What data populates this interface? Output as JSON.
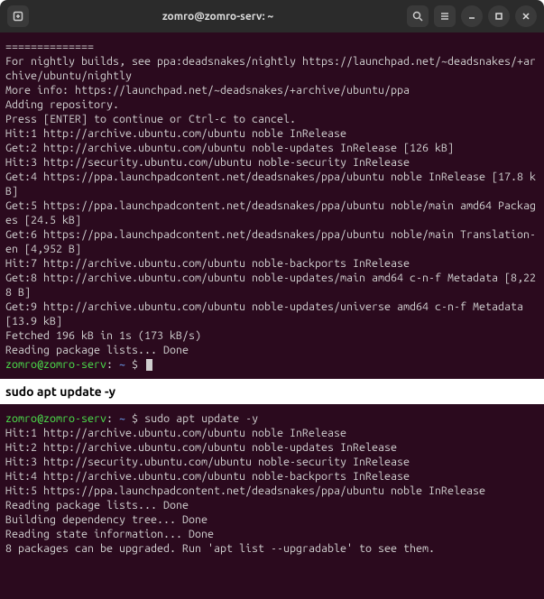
{
  "titlebar": {
    "title": "zomro@zomro-serv: ~"
  },
  "prompt": {
    "user": "zomro@zomro-serv",
    "path": "~",
    "sep": ":",
    "sign": "$"
  },
  "term1": {
    "lines": [
      "==============",
      "",
      "For nightly builds, see ppa:deadsnakes/nightly https://launchpad.net/~deadsnakes/+archive/ubuntu/nightly",
      "More info: https://launchpad.net/~deadsnakes/+archive/ubuntu/ppa",
      "Adding repository.",
      "Press [ENTER] to continue or Ctrl-c to cancel.",
      "Hit:1 http://archive.ubuntu.com/ubuntu noble InRelease",
      "Get:2 http://archive.ubuntu.com/ubuntu noble-updates InRelease [126 kB]",
      "Hit:3 http://security.ubuntu.com/ubuntu noble-security InRelease",
      "Get:4 https://ppa.launchpadcontent.net/deadsnakes/ppa/ubuntu noble InRelease [17.8 kB]",
      "Get:5 https://ppa.launchpadcontent.net/deadsnakes/ppa/ubuntu noble/main amd64 Packages [24.5 kB]",
      "Get:6 https://ppa.launchpadcontent.net/deadsnakes/ppa/ubuntu noble/main Translation-en [4,952 B]",
      "Hit:7 http://archive.ubuntu.com/ubuntu noble-backports InRelease",
      "Get:8 http://archive.ubuntu.com/ubuntu noble-updates/main amd64 c-n-f Metadata [8,228 B]",
      "Get:9 http://archive.ubuntu.com/ubuntu noble-updates/universe amd64 c-n-f Metadata [13.9 kB]",
      "Fetched 196 kB in 1s (173 kB/s)",
      "Reading package lists... Done"
    ]
  },
  "heading": "sudo apt update -y",
  "term2": {
    "cmd": "sudo apt update -y",
    "lines": [
      "Hit:1 http://archive.ubuntu.com/ubuntu noble InRelease",
      "Hit:2 http://archive.ubuntu.com/ubuntu noble-updates InRelease",
      "Hit:3 http://security.ubuntu.com/ubuntu noble-security InRelease",
      "Hit:4 http://archive.ubuntu.com/ubuntu noble-backports InRelease",
      "Hit:5 https://ppa.launchpadcontent.net/deadsnakes/ppa/ubuntu noble InRelease",
      "Reading package lists... Done",
      "Building dependency tree... Done",
      "Reading state information... Done",
      "8 packages can be upgraded. Run 'apt list --upgradable' to see them."
    ]
  }
}
